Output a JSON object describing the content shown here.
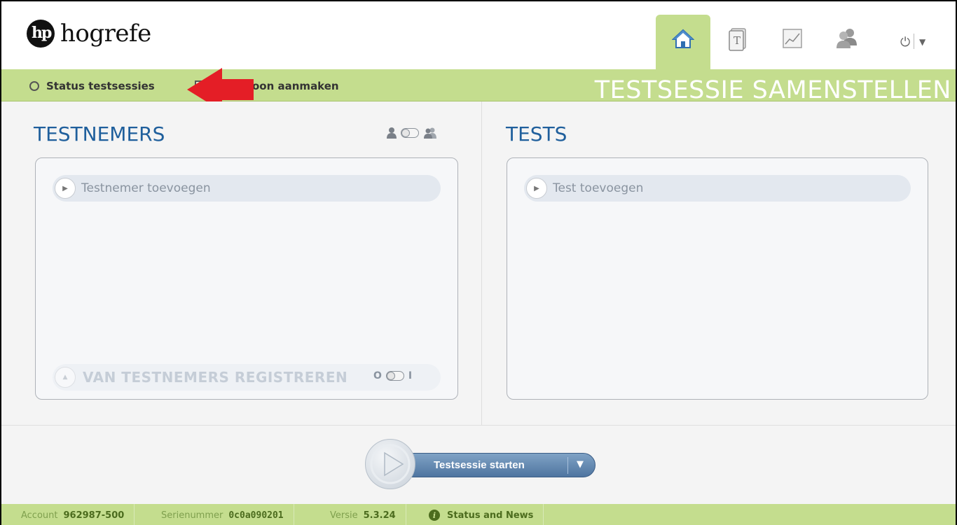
{
  "brand": {
    "logo_text": "hogrefe",
    "logo_mark": "hp"
  },
  "nav": {
    "tabs": [
      {
        "icon": "home-icon",
        "active": true
      },
      {
        "icon": "test-book-icon",
        "active": false
      },
      {
        "icon": "chart-icon",
        "active": false
      },
      {
        "icon": "users-icon",
        "active": false
      }
    ],
    "power_icon": "power-icon"
  },
  "subbar": {
    "status_label": "Status testsessies",
    "create_label": "oon aanmaken",
    "page_heading": "TESTSESSIE SAMENSTELLEN"
  },
  "testnemers": {
    "title": "TESTNEMERS",
    "add_label": "Testnemer toevoegen",
    "register_label": "VAN TESTNEMERS REGISTREREN",
    "register_toggle_off": "O",
    "register_toggle_on": "I"
  },
  "tests": {
    "title": "TESTS",
    "add_label": "Test toevoegen"
  },
  "start": {
    "label": "Testsessie starten"
  },
  "footer": {
    "account_label": "Account",
    "account_value": "962987-500",
    "serial_label": "Serienummer",
    "serial_value": "0c0a090201",
    "version_label": "Versie",
    "version_value": "5.3.24",
    "news_label": "Status and News"
  },
  "colors": {
    "accent_green": "#c4dd8e",
    "title_blue": "#1f5f9c",
    "annotation_red": "#e41e26"
  }
}
